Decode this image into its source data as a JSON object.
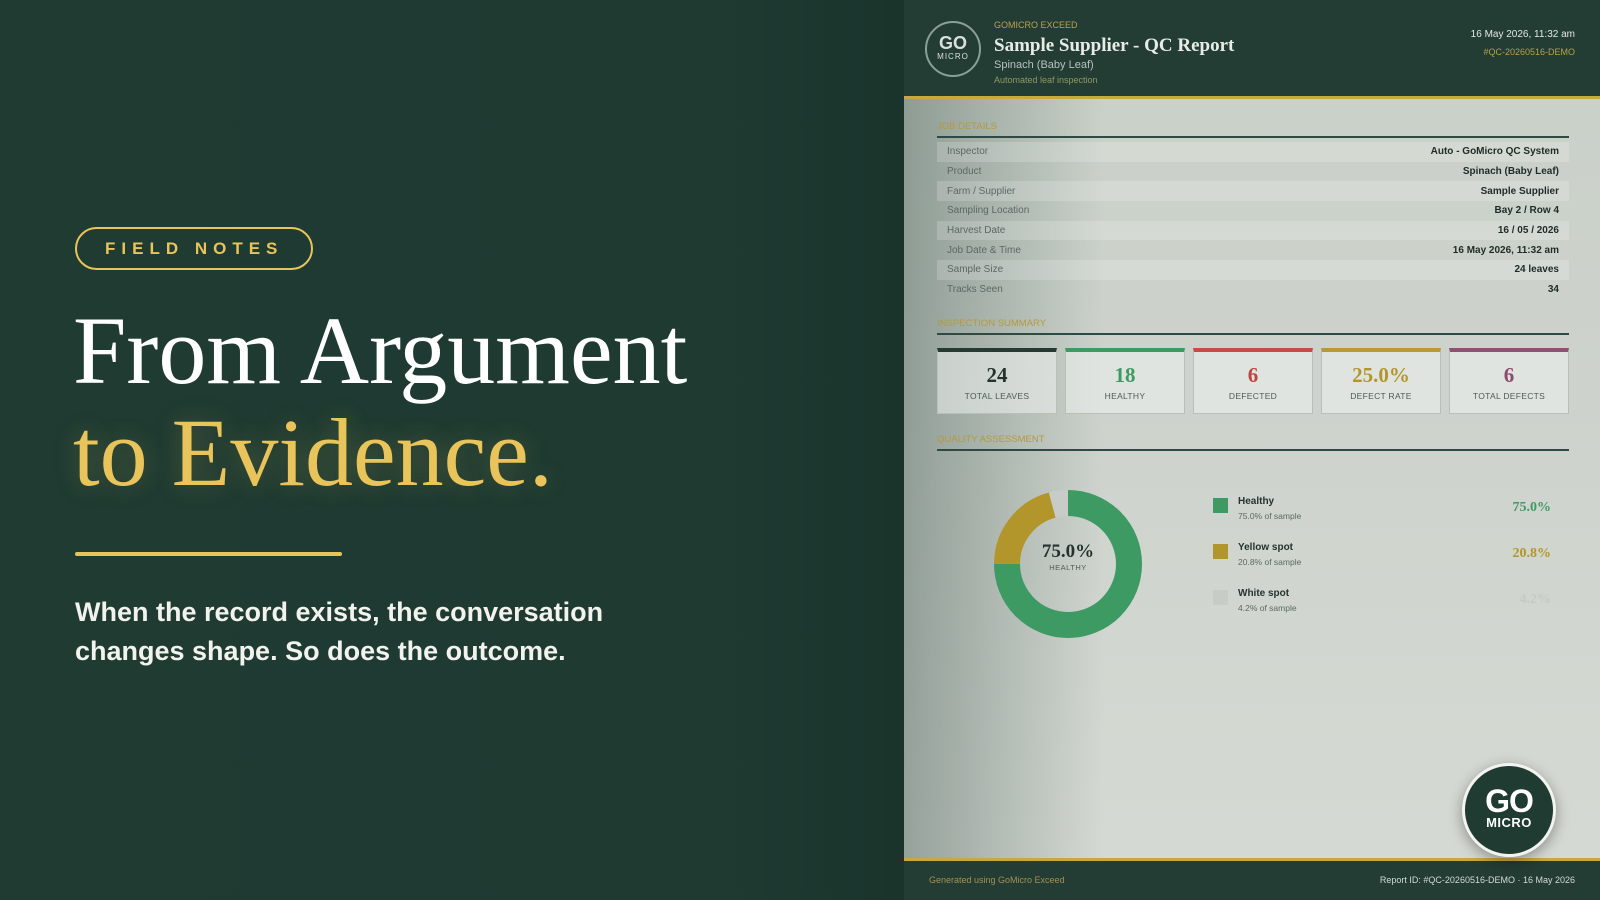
{
  "slide": {
    "eyebrow": "FIELD NOTES",
    "headline_line1": "From Argument",
    "headline_line2": "to Evidence.",
    "lede": "When the record exists, the conversation changes shape. So does the outcome.",
    "accent_color": "#e8c45a",
    "background_color": "#1e3a31"
  },
  "report": {
    "header": {
      "logo_top": "GO",
      "logo_bottom": "MICRO",
      "brand": "GOMICRO EXCEED",
      "title": "Sample Supplier - QC Report",
      "product": "Spinach (Baby Leaf)",
      "subtitle": "Automated leaf inspection",
      "datetime": "16 May 2026, 11:32 am",
      "report_id": "#QC-20260516-DEMO"
    },
    "job_details": {
      "title": "JOB DETAILS",
      "rows": [
        {
          "key": "Inspector",
          "value": "Auto - GoMicro QC System"
        },
        {
          "key": "Product",
          "value": "Spinach (Baby Leaf)"
        },
        {
          "key": "Farm / Supplier",
          "value": "Sample Supplier"
        },
        {
          "key": "Sampling Location",
          "value": "Bay 2 / Row 4"
        },
        {
          "key": "Harvest Date",
          "value": "16 / 05 / 2026"
        },
        {
          "key": "Job Date & Time",
          "value": "16 May 2026, 11:32 am"
        },
        {
          "key": "Sample Size",
          "value": "24 leaves"
        },
        {
          "key": "Tracks Seen",
          "value": "34"
        }
      ]
    },
    "inspection_summary": {
      "title": "INSPECTION SUMMARY",
      "cards": [
        {
          "value": "24",
          "label": "TOTAL LEAVES",
          "color": "#26332d",
          "top_color": "#243a32"
        },
        {
          "value": "18",
          "label": "HEALTHY",
          "color": "#3d9a63",
          "top_color": "#3d9a63"
        },
        {
          "value": "6",
          "label": "DEFECTED",
          "color": "#c0433f",
          "top_color": "#c64a45"
        },
        {
          "value": "25.0%",
          "label": "DEFECT RATE",
          "color": "#b3962b",
          "top_color": "#b79a35"
        },
        {
          "value": "6",
          "label": "TOTAL DEFECTS",
          "color": "#8b4a6e",
          "top_color": "#8b5272"
        }
      ]
    },
    "quality_assessment": {
      "title": "QUALITY ASSESSMENT",
      "center_value": "75.0%",
      "center_label": "HEALTHY"
    },
    "footer": {
      "left": "Generated using GoMicro Exceed",
      "right": "Report ID: #QC-20260516-DEMO  ·  16 May 2026"
    },
    "badge": {
      "top": "GO",
      "bottom": "MICRO"
    }
  },
  "chart_data": {
    "type": "pie",
    "title": "",
    "series": [
      {
        "name": "Healthy",
        "value": 75.0,
        "sub": "75.0% of sample",
        "pct_label": "75.0%",
        "color": "#3d9a63",
        "label_color": "#3d9a63"
      },
      {
        "name": "Yellow spot",
        "value": 20.8,
        "sub": "20.8% of sample",
        "pct_label": "20.8%",
        "color": "#b3962b",
        "label_color": "#b3962b"
      },
      {
        "name": "White spot",
        "value": 4.2,
        "sub": "4.2% of sample",
        "pct_label": "4.2%",
        "color": "#c8ccc7",
        "label_color": "#c5cac4"
      }
    ]
  }
}
